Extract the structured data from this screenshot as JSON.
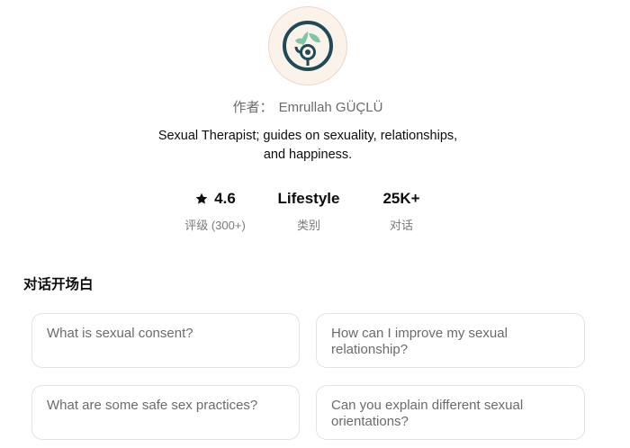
{
  "gpt": {
    "author_prefix": "作者：",
    "author_name": "Emrullah GÜÇLÜ",
    "description_line1": "Sexual Therapist; guides on sexuality, relationships,",
    "description_line2": "and happiness.",
    "logo_icon": "lotus-circle-logo-icon",
    "colors": {
      "logo_dark": "#1f4a57",
      "logo_green": "#7fc6a8",
      "avatar_bg": "#fbf3ea"
    }
  },
  "stats": {
    "rating_value": "4.6",
    "rating_label": "评级 (300+)",
    "rating_icon": "star-icon",
    "category_value": "Lifestyle",
    "category_label": "类别",
    "chats_value": "25K+",
    "chats_label": "对话"
  },
  "starters": {
    "title": "对话开场白",
    "items": [
      "What is sexual consent?",
      "How can I improve my sexual relationship?",
      "What are some safe sex practices?",
      "Can you explain different sexual orientations?"
    ]
  }
}
